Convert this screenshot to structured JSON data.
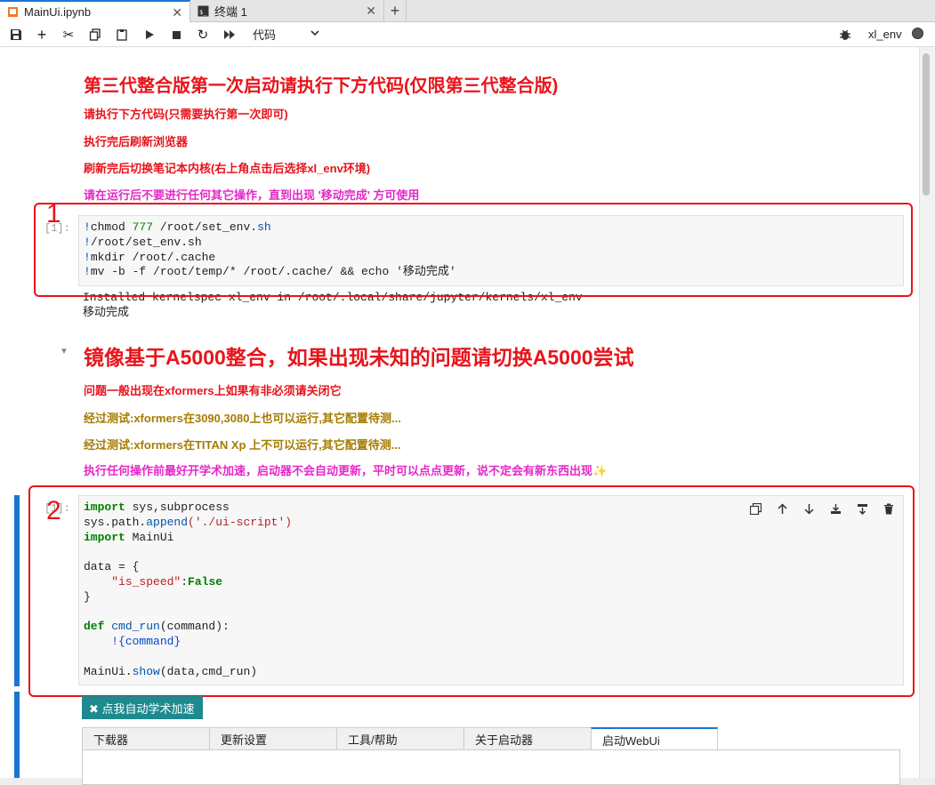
{
  "tabs": [
    {
      "label": "MainUi.ipynb",
      "icon": "notebook-icon",
      "active": true
    },
    {
      "label": "终端 1",
      "icon": "terminal-icon",
      "active": false
    }
  ],
  "toolbar": {
    "cell_type": "代码",
    "kernel_name": "xl_env"
  },
  "markdown1": {
    "title": "第三代整合版第一次启动请执行下方代码(仅限第三代整合版)",
    "line1": "请执行下方代码(只需要执行第一次即可)",
    "line2": "执行完后刷新浏览器",
    "line3": "刷新完后切换笔记本内核(右上角点击后选择xl_env环境)",
    "line4": "请在运行后不要进行任何其它操作，直到出现 '移动完成' 方可使用"
  },
  "cell1": {
    "prompt": "[1]:",
    "code": [
      {
        "bang": "!",
        "text": "chmod "
      },
      {
        "bang": "!",
        "text": "/root/set_env.sh"
      },
      {
        "bang": "!",
        "text": "mkdir /root/.cache"
      },
      {
        "bang": "!",
        "text": "mv -b -f /root/temp/* /root/.cache/ && echo '移动完成'"
      }
    ],
    "output_line1": "Installed kernelspec xl_env in /root/.local/share/jupyter/kernels/xl_env",
    "output_line2": "移动完成"
  },
  "markdown2": {
    "title": "镜像基于A5000整合，如果出现未知的问题请切换A5000尝试",
    "line1": "问题一般出现在xformers上如果有非必须请关闭它",
    "line2": "经过测试:xformers在3090,3080上也可以运行,其它配置待测...",
    "line3": "经过测试:xformers在TITAN Xp 上不可以运行,其它配置待测...",
    "line4": "执行任何操作前最好开学术加速，启动器不会自动更新，平时可以点点更新，说不定会有新东西出现✨"
  },
  "cell2": {
    "prompt": "[1]:",
    "t_import": "import",
    "t_sys": " sys,subprocess",
    "t_syspath": "sys.path.",
    "t_append": "append",
    "t_arg": "('./ui-script')",
    "t_mainui": " MainUi",
    "t_data": "data = {",
    "t_key": "\"is_speed\"",
    "t_false": "False",
    "t_close": "}",
    "t_def": "def",
    "t_fname": "cmd_run",
    "t_params": "(command):",
    "t_body": "!{command}",
    "t_call1": "MainUi.",
    "t_show": "show",
    "t_call2": "(data,cmd_run)"
  },
  "annotations": [
    "1",
    "2"
  ],
  "widget": {
    "speed_button": "✖ 点我自动学术加速",
    "tabs": [
      "下载器",
      "更新设置",
      "工具/帮助",
      "关于启动器",
      "启动WebUi"
    ],
    "active_tab": "启动WebUi"
  },
  "colors": {
    "accent": "#1976d2",
    "heading_red": "#e8141b",
    "gold": "#a67c00",
    "magenta": "#e528c8",
    "button_teal": "#1e8a8f"
  }
}
